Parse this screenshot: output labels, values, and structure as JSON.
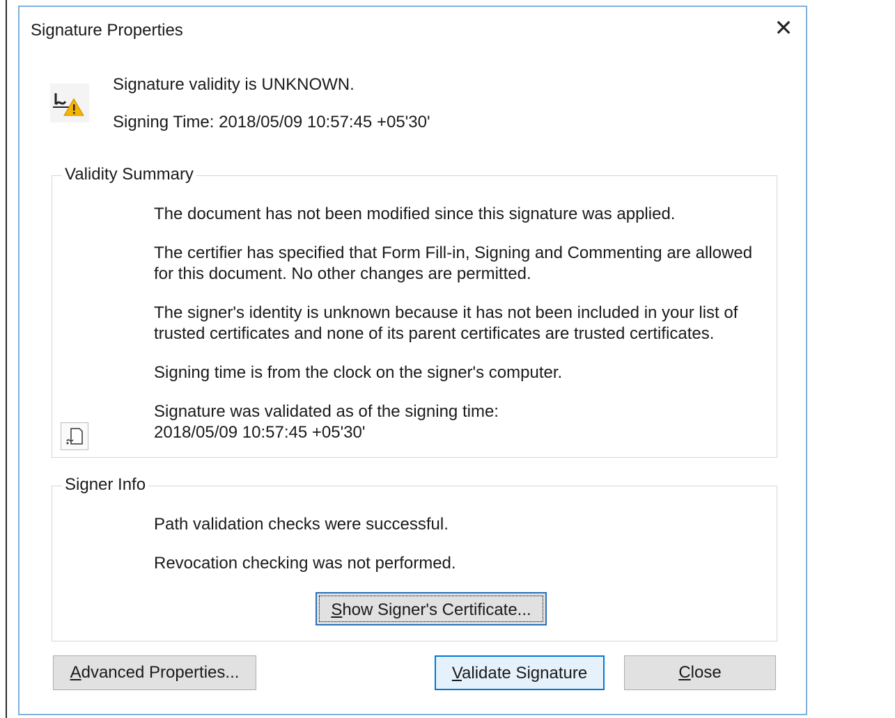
{
  "window": {
    "title": "Signature Properties",
    "close_glyph": "✕"
  },
  "status": {
    "icon": "signature-warning-icon",
    "validity": "Signature validity is UNKNOWN.",
    "signing_time": "Signing Time:  2018/05/09 10:57:45 +05'30'"
  },
  "validity_summary": {
    "legend": "Validity Summary",
    "paragraphs": [
      "The document has not been modified since this signature was applied.",
      "The certifier has specified that Form Fill-in, Signing and Commenting are allowed for this document. No other changes are permitted.",
      "The signer's identity is unknown because it has not been included in your list of trusted certificates and none of its parent certificates are trusted certificates.",
      "Signing time is from the clock on the signer's computer.",
      "Signature was validated as of the signing time:\n2018/05/09 10:57:45 +05'30'"
    ],
    "doc_icon": "document-signature-icon"
  },
  "signer_info": {
    "legend": "Signer Info",
    "paragraphs": [
      "Path validation checks were successful.",
      "Revocation checking was not performed."
    ],
    "show_cert_button": {
      "mnemonic": "S",
      "rest": "how Signer's Certificate..."
    }
  },
  "buttons": {
    "advanced": {
      "mnemonic": "A",
      "rest": "dvanced Properties..."
    },
    "validate": {
      "mnemonic": "V",
      "rest": "alidate Signature"
    },
    "close": {
      "mnemonic": "C",
      "rest": "lose"
    }
  },
  "colors": {
    "accent": "#0078d7",
    "warning": "#f5b400",
    "dialog_border": "#7fb0de"
  }
}
